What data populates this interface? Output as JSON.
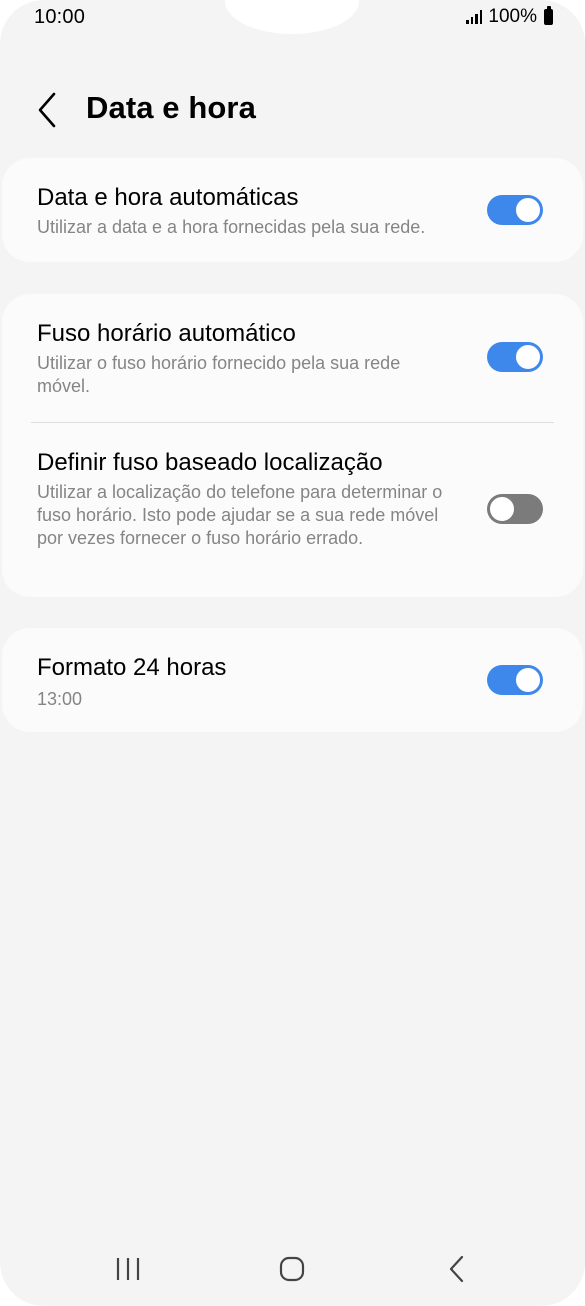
{
  "status_bar": {
    "time": "10:00",
    "battery": "100%",
    "icons": [
      "signal-icon",
      "battery-icon"
    ]
  },
  "header": {
    "back_icon": "chevron-left-icon",
    "title": "Data e hora"
  },
  "settings": {
    "auto_datetime": {
      "title": "Data e hora automáticas",
      "subtitle": "Utilizar a data e a hora fornecidas pela sua rede.",
      "enabled": true
    },
    "auto_timezone": {
      "title": "Fuso horário automático",
      "subtitle": "Utilizar o fuso horário fornecido pela sua rede móvel.",
      "enabled": true
    },
    "location_timezone": {
      "title": "Definir fuso baseado localização",
      "subtitle": "Utilizar a localização do telefone para determinar o fuso horário. Isto pode ajudar se a sua rede móvel por vezes fornecer o fuso horário errado.",
      "enabled": false
    },
    "format_24h": {
      "title": "Formato 24 horas",
      "subtitle": "13:00",
      "enabled": true
    }
  },
  "nav_bar": {
    "icons": [
      "recent-apps-icon",
      "home-icon",
      "back-icon"
    ]
  },
  "colors": {
    "background": "#f4f4f4",
    "card": "#fbfbfb",
    "toggle_on": "#3e88eb",
    "toggle_off": "#7b7b7b",
    "subtitle": "#858585"
  }
}
